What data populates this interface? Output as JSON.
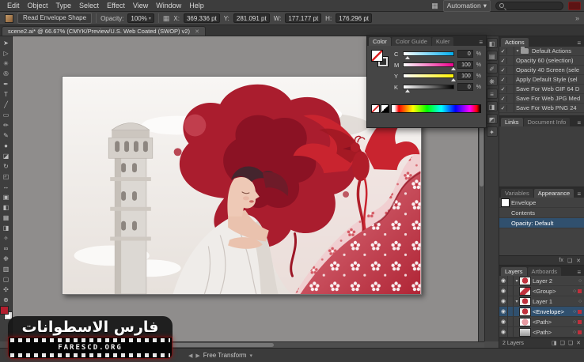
{
  "menu": {
    "items": [
      "Edit",
      "Object",
      "Type",
      "Select",
      "Effect",
      "View",
      "Window",
      "Help"
    ],
    "workspace": "Automation"
  },
  "control_bar": {
    "read_envelope_button": "Read Envelope Shape",
    "opacity_label": "Opacity:",
    "opacity_value": "100%",
    "x_label": "X:",
    "x_value": "369.336 pt",
    "y_label": "Y:",
    "y_value": "281.091 pt",
    "w_label": "W:",
    "w_value": "177.177 pt",
    "h_label": "H:",
    "h_value": "176.296 pt"
  },
  "document_tab": {
    "title": "scene2.ai* @ 66.67% (CMYK/Preview/U.S. Web Coated (SWOP) v2)"
  },
  "color_panel": {
    "tabs": [
      "Color",
      "Color Guide",
      "Kuler"
    ],
    "sliders": [
      {
        "label": "C",
        "value": "0"
      },
      {
        "label": "M",
        "value": "100"
      },
      {
        "label": "Y",
        "value": "100"
      },
      {
        "label": "K",
        "value": "0"
      }
    ],
    "percent": "%"
  },
  "actions_panel": {
    "tab": "Actions",
    "items": [
      "Default Actions",
      "Opacity 60 (selection)",
      "Opacity 40 Screen (sele",
      "Apply Default Style (sel",
      "Save For Web GIF 64 D",
      "Save For Web JPG Med",
      "Save For Web PNG 24"
    ]
  },
  "links_panel": {
    "tabs": [
      "Links",
      "Document Info"
    ]
  },
  "appearance_panel": {
    "tabs": [
      "Variables",
      "Appearance"
    ],
    "rows": [
      "Envelope",
      "Contents",
      "Opacity: Default"
    ]
  },
  "layers_panel": {
    "tabs": [
      "Layers",
      "Artboards"
    ],
    "rows": [
      {
        "label": "Layer 2"
      },
      {
        "label": "<Group>"
      },
      {
        "label": "Layer 1"
      },
      {
        "label": "<Envelope>"
      },
      {
        "label": "<Path>"
      },
      {
        "label": "<Path>"
      }
    ],
    "status": "2 Layers"
  },
  "status_bar": {
    "tool": "Free Transform"
  },
  "watermark": {
    "line1": "فارس الاسطوانات",
    "line2": "FARESCD.ORG"
  },
  "icons": {
    "check": "✓",
    "chevron_down": "▾",
    "chevron_right": "▸",
    "panel_menu": "≡",
    "close": "✕",
    "arrow_left": "◀",
    "arrow_right": "▶",
    "eye": "◉",
    "target": "○",
    "double_chevron": "»",
    "ref_grid": "▦",
    "app_grid": "▦",
    "new_layer": "❏",
    "new_sublayer": "❑",
    "mask": "◨",
    "trash": "✕",
    "fx": "fx"
  },
  "toolbar": {
    "tools": [
      {
        "n": "selection-tool",
        "g": "➤"
      },
      {
        "n": "direct-selection-tool",
        "g": "▷"
      },
      {
        "n": "magic-wand-tool",
        "g": "✳"
      },
      {
        "n": "lasso-tool",
        "g": "✇"
      },
      {
        "n": "pen-tool",
        "g": "✒"
      },
      {
        "n": "type-tool",
        "g": "T"
      },
      {
        "n": "line-segment-tool",
        "g": "╱"
      },
      {
        "n": "rectangle-tool",
        "g": "▭"
      },
      {
        "n": "paintbrush-tool",
        "g": "✏"
      },
      {
        "n": "pencil-tool",
        "g": "✎"
      },
      {
        "n": "blob-brush-tool",
        "g": "●"
      },
      {
        "n": "eraser-tool",
        "g": "◪"
      },
      {
        "n": "rotate-tool",
        "g": "↻"
      },
      {
        "n": "scale-tool",
        "g": "◰"
      },
      {
        "n": "width-tool",
        "g": "↔"
      },
      {
        "n": "free-transform-tool",
        "g": "▣"
      },
      {
        "n": "shape-builder-tool",
        "g": "◧"
      },
      {
        "n": "mesh-tool",
        "g": "▦"
      },
      {
        "n": "gradient-tool",
        "g": "◨"
      },
      {
        "n": "eyedropper-tool",
        "g": "✧"
      },
      {
        "n": "blend-tool",
        "g": "∞"
      },
      {
        "n": "symbol-sprayer-tool",
        "g": "❉"
      },
      {
        "n": "column-graph-tool",
        "g": "▥"
      },
      {
        "n": "artboard-tool",
        "g": "▢"
      },
      {
        "n": "hand-tool",
        "g": "✣"
      },
      {
        "n": "zoom-tool",
        "g": "⊕"
      }
    ]
  },
  "dock_strip": {
    "icons": [
      "◧",
      "▤",
      "✐",
      "❋",
      "≡",
      "◨",
      "◩",
      "✦"
    ]
  }
}
